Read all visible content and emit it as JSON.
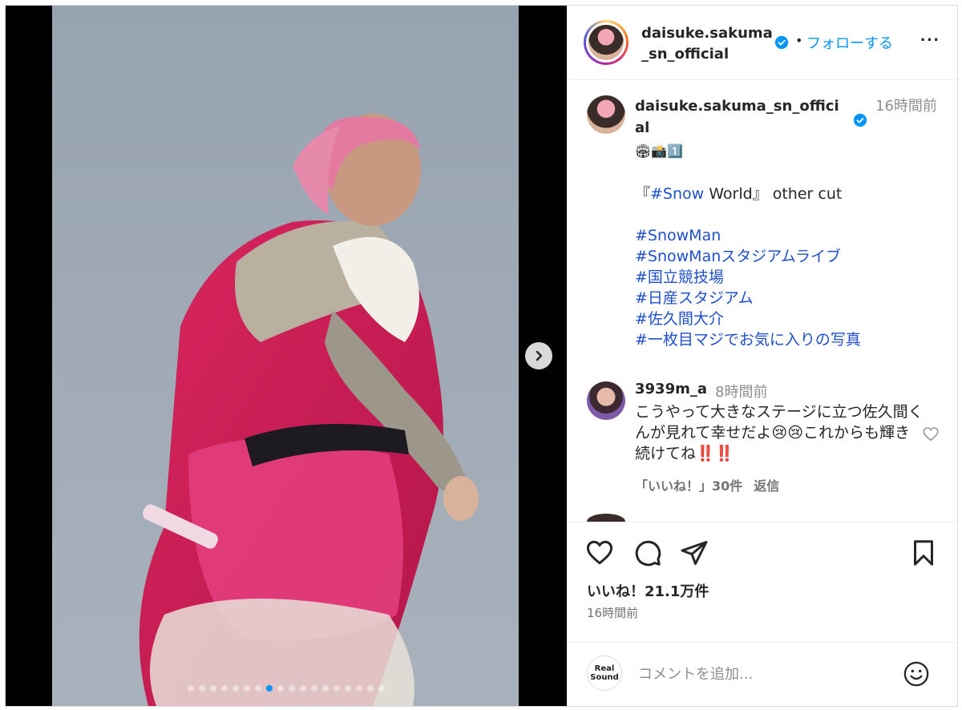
{
  "post": {
    "username_header": "daisuke.sakuma_sn_official",
    "follow_label": "フォローする",
    "separator": "•",
    "more_label": "···",
    "carousel": {
      "total": 18,
      "active_index": 7
    }
  },
  "caption": {
    "username": "daisuke.sakuma_sn_official",
    "time": "16時間前",
    "emojis": "🏟📸1️⃣",
    "line1_prefix": "『",
    "line1_tag": "#Snow",
    "line1_suffix": " World』 other cut",
    "hashtags": [
      "#SnowMan",
      "#SnowManスタジアムライブ",
      "#国立競技場",
      "#日産スタジアム",
      "#佐久間大介",
      "#一枚目マジでお気に入りの写真"
    ]
  },
  "comment": {
    "username": "3939m_a",
    "time": "8時間前",
    "text": "こうやって大きなステージに立つ佐久間くんが見れて幸せだよ😢😢これからも輝き続けてね‼️‼️",
    "likes": "「いいね！」30件",
    "reply": "返信"
  },
  "stats": {
    "likes": "いいね！21.1万件",
    "time": "16時間前"
  },
  "comment_bar": {
    "logo_text": "Real Sound",
    "placeholder": "コメントを追加..."
  },
  "colors": {
    "accent": "#0095f6",
    "hashtag": "#1f4fcc",
    "muted": "#8e8e8e"
  }
}
